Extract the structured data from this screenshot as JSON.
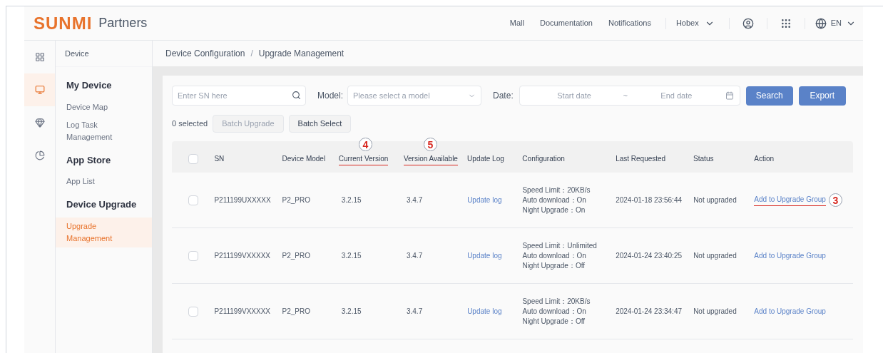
{
  "logo": {
    "brand": "SUNMI",
    "product": "Partners"
  },
  "top_nav": {
    "links": [
      "Mall",
      "Documentation",
      "Notifications"
    ],
    "account": "Hobex",
    "language": "EN"
  },
  "rail": [
    {
      "selected": false
    },
    {
      "selected": true
    },
    {
      "selected": false
    },
    {
      "selected": false
    }
  ],
  "sidebar": {
    "title": "Device",
    "sections": [
      {
        "heading": "My Device",
        "items": [
          {
            "label": "Device Map",
            "selected": false
          },
          {
            "label": "Log Task Management",
            "selected": false
          }
        ]
      },
      {
        "heading": "App Store",
        "items": [
          {
            "label": "App List",
            "selected": false
          }
        ]
      },
      {
        "heading": "Device Upgrade",
        "items": [
          {
            "label": "Upgrade Management",
            "selected": true
          }
        ]
      }
    ]
  },
  "breadcrumb": {
    "items": [
      "Device Configuration",
      "Upgrade Management"
    ],
    "separator": "/"
  },
  "filters": {
    "sn_placeholder": "Enter SN here",
    "model_label": "Model:",
    "model_placeholder": "Please select a model",
    "date_label": "Date:",
    "start_placeholder": "Start date",
    "separator": "~",
    "end_placeholder": "End date",
    "buttons": [
      "Search",
      "Export"
    ]
  },
  "selection": {
    "count": "0 selected",
    "buttons": [
      {
        "label": "Batch Upgrade",
        "disabled": true
      },
      {
        "label": "Batch Select",
        "disabled": false
      }
    ]
  },
  "table": {
    "header_checked": false,
    "columns": [
      {
        "label": "SN"
      },
      {
        "label": "Device Model"
      },
      {
        "label": "Current Version",
        "callout": "4"
      },
      {
        "label": "Version Available",
        "callout": "5"
      },
      {
        "label": "Update Log"
      },
      {
        "label": "Configuration"
      },
      {
        "label": "Last Requested"
      },
      {
        "label": "Status"
      },
      {
        "label": "Action"
      }
    ],
    "rows": [
      {
        "checked": false,
        "sn": "P211199UXXXXX",
        "model": "P2_PRO",
        "current": "3.2.15",
        "available": "3.4.7",
        "log": "Update log",
        "config": [
          "Speed Limit：20KB/s",
          "Auto download：On",
          "Night Upgrade：On"
        ],
        "last": "2024-01-18 23:56:44",
        "status": "Not upgraded",
        "action": "Add to Upgrade Group",
        "callout": "3"
      },
      {
        "checked": false,
        "sn": "P211199VXXXXX",
        "model": "P2_PRO",
        "current": "3.2.15",
        "available": "3.4.7",
        "log": "Update log",
        "config": [
          "Speed Limit：Unlimited",
          "Auto download：On",
          "Night Upgrade：Off"
        ],
        "last": "2024-01-24 23:40:25",
        "status": "Not upgraded",
        "action": "Add to Upgrade Group"
      },
      {
        "checked": false,
        "sn": "P211199VXXXXX",
        "model": "P2_PRO",
        "current": "3.2.15",
        "available": "3.4.7",
        "log": "Update log",
        "config": [
          "Speed Limit：20KB/s",
          "Auto download：On",
          "Night Upgrade：Off"
        ],
        "last": "2024-01-24 23:34:47",
        "status": "Not upgraded",
        "action": "Add to Upgrade Group"
      }
    ]
  }
}
